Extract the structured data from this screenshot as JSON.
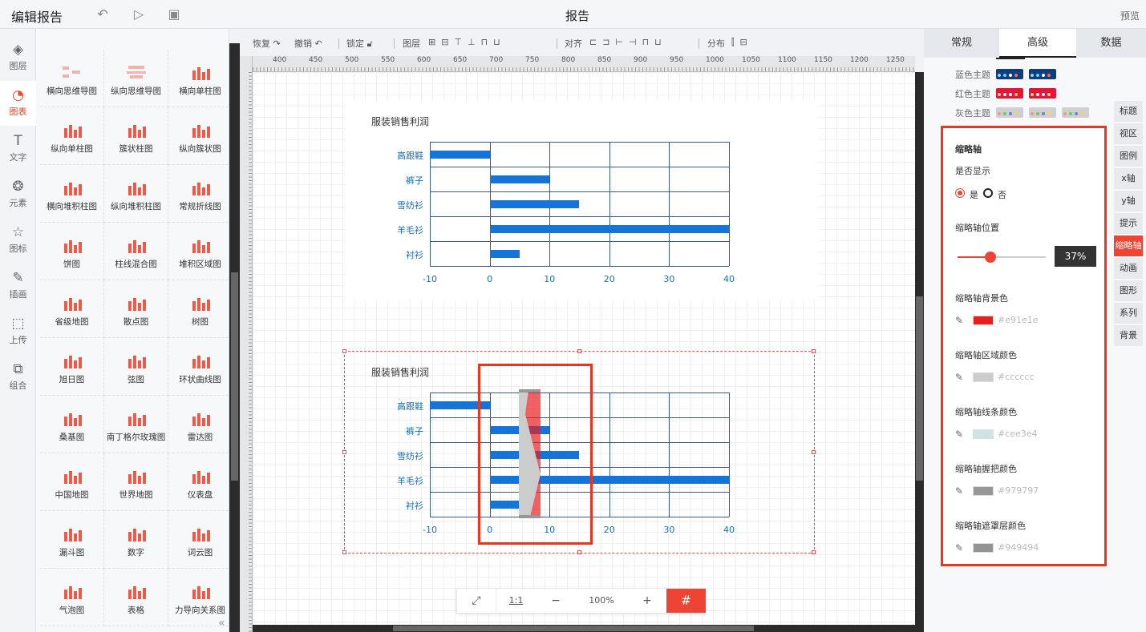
{
  "header": {
    "app_title": "编辑报告",
    "doc_title": "报告",
    "preview": "预览"
  },
  "rail": [
    {
      "label": "图层",
      "icon": "layers-icon",
      "glyph": "◈"
    },
    {
      "label": "图表",
      "icon": "chart-icon",
      "glyph": "◔",
      "active": true
    },
    {
      "label": "文字",
      "icon": "text-icon",
      "glyph": "T"
    },
    {
      "label": "元素",
      "icon": "elements-icon",
      "glyph": "❂"
    },
    {
      "label": "图标",
      "icon": "star-icon",
      "glyph": "☆"
    },
    {
      "label": "插画",
      "icon": "palette-icon",
      "glyph": "✎"
    },
    {
      "label": "上传",
      "icon": "upload-icon",
      "glyph": "⬚"
    },
    {
      "label": "组合",
      "icon": "group-icon",
      "glyph": "⧉"
    }
  ],
  "library": [
    "横向思维导图",
    "纵向思维导图",
    "横向单柱图",
    "纵向单柱图",
    "簇状柱图",
    "纵向簇状图",
    "横向堆积柱图",
    "纵向堆积柱图",
    "常规折线图",
    "饼图",
    "柱线混合图",
    "堆积区域图",
    "省级地图",
    "散点图",
    "树图",
    "旭日图",
    "弦图",
    "环状曲线图",
    "桑基图",
    "南丁格尔玫瑰图",
    "雷达图",
    "中国地图",
    "世界地图",
    "仪表盘",
    "漏斗图",
    "数字",
    "词云图",
    "气泡图",
    "表格",
    "力导向关系图"
  ],
  "toolbar": {
    "redo": "恢复",
    "undo": "撤销",
    "lock": "锁定",
    "layer": "图层",
    "align": "对齐",
    "distribute": "分布"
  },
  "ruler_ticks": [
    "400",
    "450",
    "500",
    "550",
    "600",
    "650",
    "700",
    "750",
    "800",
    "850",
    "900",
    "950",
    "1000",
    "1050",
    "1100",
    "1150",
    "1200",
    "1250"
  ],
  "charts": [
    {
      "chart_data": {
        "type": "bar",
        "orientation": "horizontal",
        "title": "服装销售利润",
        "categories": [
          "高跟鞋",
          "裤子",
          "雪纺衫",
          "羊毛衫",
          "衬衫"
        ],
        "values": [
          -10,
          10,
          15,
          40,
          5
        ],
        "xlim": [
          -10,
          40
        ],
        "xticks": [
          "-10",
          "0",
          "10",
          "20",
          "30",
          "40"
        ],
        "grid": true,
        "color": "#1574da"
      }
    },
    {
      "chart_data": {
        "type": "bar",
        "orientation": "horizontal",
        "title": "服装销售利润",
        "categories": [
          "高跟鞋",
          "裤子",
          "雪纺衫",
          "羊毛衫",
          "衬衫"
        ],
        "values": [
          -10,
          10,
          15,
          40,
          5
        ],
        "xlim": [
          -10,
          40
        ],
        "xticks": [
          "-10",
          "0",
          "10",
          "20",
          "30",
          "40"
        ],
        "grid": true,
        "color": "#1574da",
        "datazoom_visible": true
      }
    }
  ],
  "zoom": {
    "fit": "⤢",
    "actual": "1:1",
    "minus": "−",
    "level": "100%",
    "plus": "+",
    "grid": "#"
  },
  "panel": {
    "tabs": [
      "常规",
      "高级",
      "数据"
    ],
    "active_tab": "高级",
    "themes": [
      {
        "label": "蓝色主题",
        "bg": "#0e3f7a",
        "dots": [
          "#8fd3ff",
          "#6cf",
          "#fff",
          "#f66"
        ]
      },
      {
        "label": "红色主题",
        "bg": "#e3153a",
        "dots": [
          "#ffd27a",
          "#ffe",
          "#fff",
          "#fc6"
        ]
      },
      {
        "label": "灰色主题",
        "bg": "#cfcfcf",
        "dots": [
          "#e98",
          "#6c6",
          "#68c",
          "#fc6"
        ]
      }
    ],
    "side_tabs": [
      "标题",
      "视区",
      "图例",
      "x轴",
      "y轴",
      "提示",
      "缩略轴",
      "动画",
      "图形",
      "系列",
      "背景"
    ],
    "active_side_tab": "缩略轴",
    "props": {
      "section": "缩略轴",
      "show_label": "是否显示",
      "yes": "是",
      "no": "否",
      "position_label": "缩略轴位置",
      "position_value": "37%",
      "position_fraction": 0.37,
      "colors": [
        {
          "label": "缩略轴背景色",
          "hex": "#e91e1e"
        },
        {
          "label": "缩略轴区域颜色",
          "hex": "#cccccc"
        },
        {
          "label": "缩略轴线条颜色",
          "hex": "#cee3e4"
        },
        {
          "label": "缩略轴握把颜色",
          "hex": "#979797"
        },
        {
          "label": "缩略轴遮罩层颜色",
          "hex": "#949494"
        }
      ]
    }
  }
}
